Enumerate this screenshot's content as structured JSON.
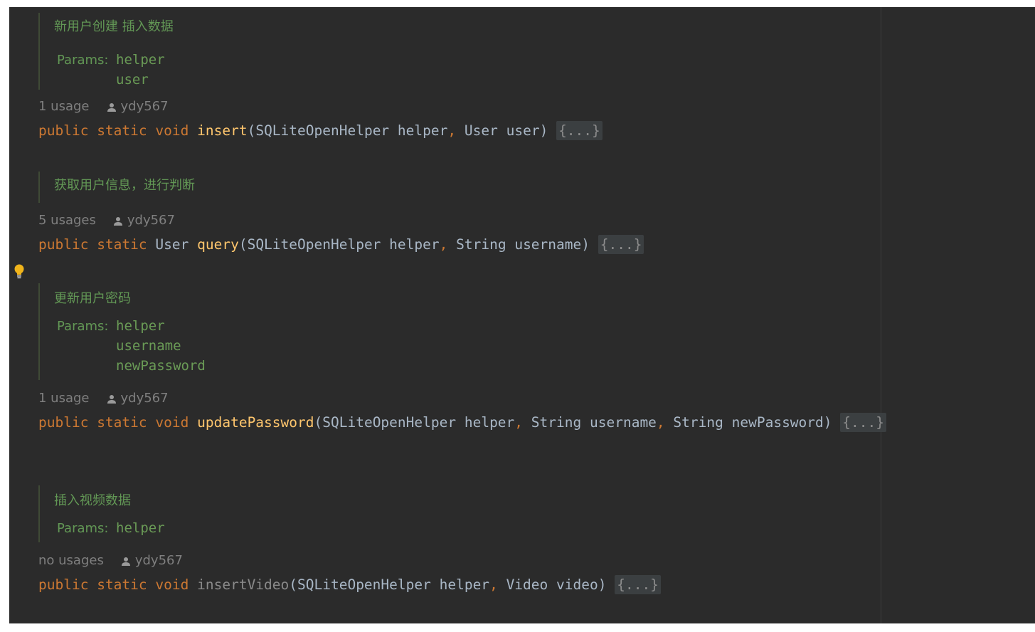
{
  "methods": [
    {
      "doc_title": "新用户创建 插入数据",
      "params_label": "Params:",
      "params": [
        "helper",
        "user"
      ],
      "usages": "1 usage",
      "author": "ydy567",
      "signature": {
        "mod1": "public",
        "mod2": "static",
        "ret": "void",
        "name": "insert",
        "open": "(",
        "p1type": "SQLiteOpenHelper",
        "p1name": "helper",
        "p2type": "User",
        "p2name": "user",
        "close": ")",
        "fold": "{...}"
      }
    },
    {
      "doc_title": "获取用户信息，进行判断",
      "usages": "5 usages",
      "author": "ydy567",
      "signature": {
        "mod1": "public",
        "mod2": "static",
        "ret": "User",
        "name": "query",
        "open": "(",
        "p1type": "SQLiteOpenHelper",
        "p1name": "helper",
        "p2type": "String",
        "p2name": "username",
        "close": ")",
        "fold": "{...}"
      }
    },
    {
      "doc_title": "更新用户密码",
      "params_label": "Params:",
      "params": [
        "helper",
        "username",
        "newPassword"
      ],
      "usages": "1 usage",
      "author": "ydy567",
      "signature": {
        "mod1": "public",
        "mod2": "static",
        "ret": "void",
        "name": "updatePassword",
        "open": "(",
        "p1type": "SQLiteOpenHelper",
        "p1name": "helper",
        "p2type": "String",
        "p2name": "username",
        "p3type": "String",
        "p3name": "newPassword",
        "close": ")",
        "fold": "{...}"
      }
    },
    {
      "doc_title": "插入视频数据",
      "params_label": "Params:",
      "params": [
        "helper"
      ],
      "usages": "no usages",
      "author": "ydy567",
      "signature": {
        "mod1": "public",
        "mod2": "static",
        "ret": "void",
        "name": "insertVideo",
        "open": "(",
        "p1type": "SQLiteOpenHelper",
        "p1name": "helper",
        "p2type": "Video",
        "p2name": "video",
        "close": ")",
        "fold": "{...}"
      }
    }
  ],
  "colors": {
    "background": "#2b2b2b",
    "keyword": "#cc7832",
    "function": "#ffc66d",
    "doc": "#629755",
    "text": "#a9b7c6",
    "meta": "#7f7f7f",
    "bulb": "#f0b41b"
  },
  "icons": {
    "intention": "lightbulb-icon",
    "author": "person-icon"
  }
}
